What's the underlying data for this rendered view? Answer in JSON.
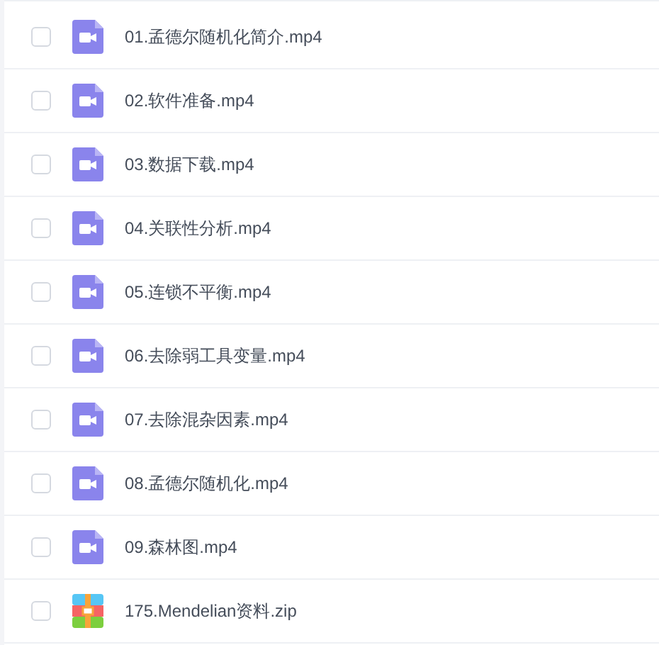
{
  "files": [
    {
      "name": "01.孟德尔随机化简介.mp4",
      "kind": "video",
      "checked": false
    },
    {
      "name": "02.软件准备.mp4",
      "kind": "video",
      "checked": false
    },
    {
      "name": "03.数据下载.mp4",
      "kind": "video",
      "checked": false
    },
    {
      "name": "04.关联性分析.mp4",
      "kind": "video",
      "checked": false
    },
    {
      "name": "05.连锁不平衡.mp4",
      "kind": "video",
      "checked": false
    },
    {
      "name": "06.去除弱工具变量.mp4",
      "kind": "video",
      "checked": false
    },
    {
      "name": "07.去除混杂因素.mp4",
      "kind": "video",
      "checked": false
    },
    {
      "name": "08.孟德尔随机化.mp4",
      "kind": "video",
      "checked": false
    },
    {
      "name": "09.森林图.mp4",
      "kind": "video",
      "checked": false
    },
    {
      "name": "175.Mendelian资料.zip",
      "kind": "zip",
      "checked": false
    }
  ]
}
